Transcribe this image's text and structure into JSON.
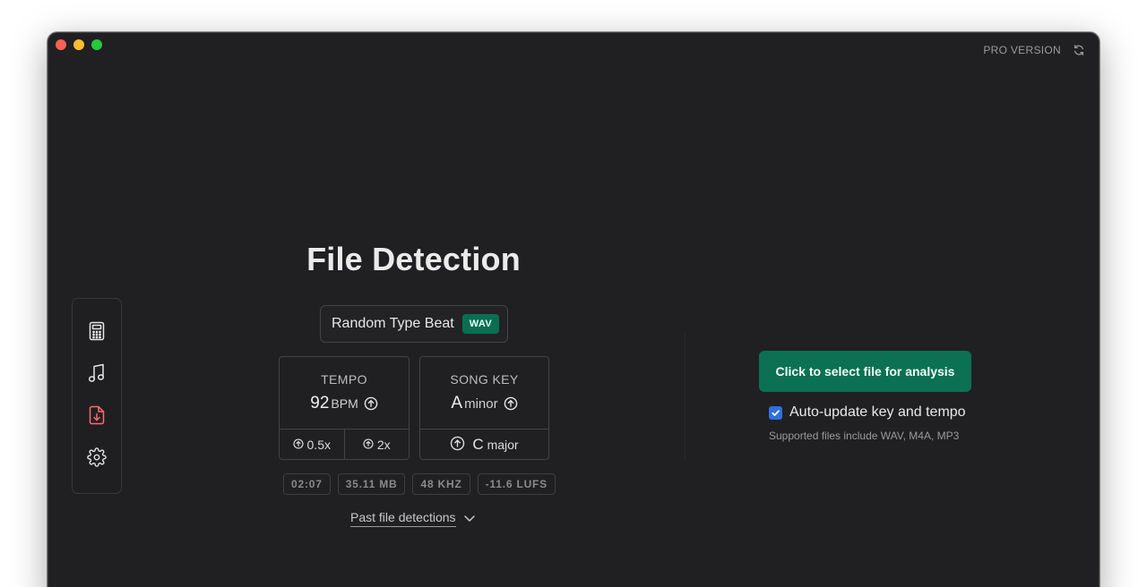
{
  "window": {
    "pro_label": "PRO VERSION"
  },
  "sidebar": {
    "items": [
      {
        "icon": "calculator-icon"
      },
      {
        "icon": "music-note-icon"
      },
      {
        "icon": "file-download-icon"
      },
      {
        "icon": "gear-icon"
      }
    ]
  },
  "main": {
    "title": "File Detection",
    "file": {
      "name": "Random Type Beat",
      "format": "WAV"
    },
    "tempo": {
      "label": "TEMPO",
      "value": "92",
      "unit": "BPM",
      "half": "0.5x",
      "double": "2x"
    },
    "key": {
      "label": "SONG KEY",
      "note": "A",
      "mode": "minor",
      "relative_note": "C",
      "relative_mode": "major"
    },
    "meta": [
      "02:07",
      "35.11 MB",
      "48 KHZ",
      "-11.6 LUFS"
    ],
    "past_label": "Past file detections"
  },
  "right": {
    "cta_label": "Click to select file for analysis",
    "auto_update_label": "Auto-update key and tempo",
    "auto_update_checked": true,
    "supported_text": "Supported files include WAV, M4A, MP3"
  },
  "colors": {
    "accent": "#0b7152",
    "checkbox": "#2f6fe0",
    "background": "#202022"
  }
}
